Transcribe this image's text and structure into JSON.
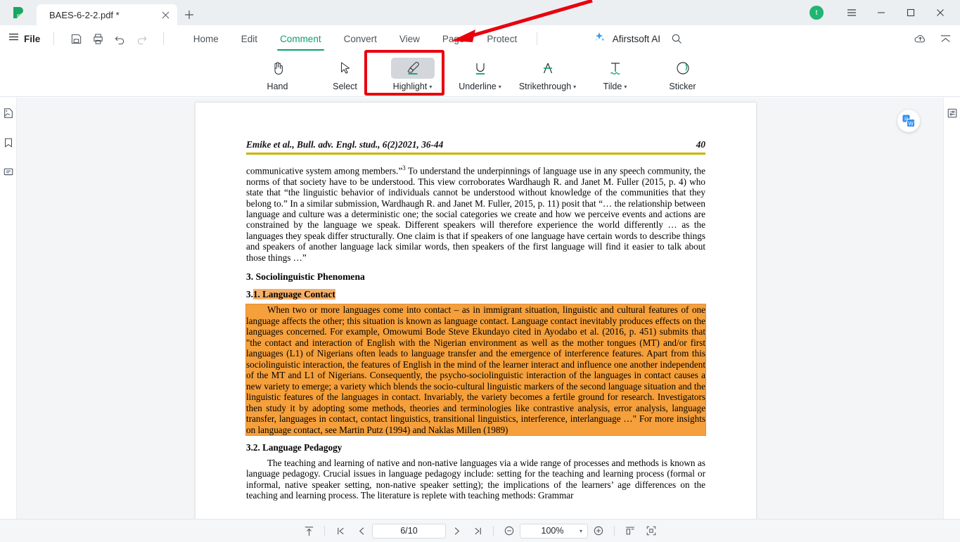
{
  "window": {
    "tab_title": "BAES-6-2-2.pdf *",
    "new_tab_icon": "plus-icon",
    "close_tab_icon": "close-icon",
    "avatar_letter": "t",
    "minimize_icon": "minimize-icon",
    "maximize_icon": "maximize-icon",
    "close_icon": "close-icon",
    "menu_icon": "hamburger-menu-icon"
  },
  "menu": {
    "file_label": "File",
    "quick_actions": [
      {
        "name": "save-icon",
        "label": "Save"
      },
      {
        "name": "print-icon",
        "label": "Print"
      },
      {
        "name": "undo-icon",
        "label": "Undo"
      },
      {
        "name": "redo-icon",
        "label": "Redo"
      }
    ],
    "tabs": [
      {
        "label": "Home",
        "active": false
      },
      {
        "label": "Edit",
        "active": false
      },
      {
        "label": "Comment",
        "active": true
      },
      {
        "label": "Convert",
        "active": false
      },
      {
        "label": "View",
        "active": false
      },
      {
        "label": "Page",
        "active": false
      },
      {
        "label": "Protect",
        "active": false
      }
    ],
    "ai_label": "Afirstsoft AI",
    "search_icon": "search-icon",
    "cloud_icon": "cloud-upload-icon",
    "collapse_icon": "collapse-ribbon-icon",
    "accent_color": "#0aa06e"
  },
  "ribbon": {
    "tools": [
      {
        "label": "Hand",
        "icon": "hand-icon",
        "dropdown": false,
        "active": false
      },
      {
        "label": "Select",
        "icon": "cursor-select-icon",
        "dropdown": false,
        "active": false
      },
      {
        "label": "Highlight",
        "icon": "highlighter-icon",
        "dropdown": true,
        "active": true
      },
      {
        "label": "Underline",
        "icon": "underline-icon",
        "dropdown": true,
        "active": false
      },
      {
        "label": "Strikethrough",
        "icon": "strikethrough-icon",
        "dropdown": true,
        "active": false
      },
      {
        "label": "Tilde",
        "icon": "tilde-icon",
        "dropdown": true,
        "active": false
      },
      {
        "label": "Sticker",
        "icon": "sticker-icon",
        "dropdown": false,
        "active": false
      }
    ],
    "caret_glyph": "▾"
  },
  "annotation": {
    "box_color": "#e8000d",
    "arrow_color": "#e8000d",
    "target": "Highlight",
    "arrow_points_to": "Comment"
  },
  "left_rail": [
    {
      "name": "thumbnails-icon",
      "label": "Thumbnails"
    },
    {
      "name": "bookmark-icon",
      "label": "Bookmarks"
    },
    {
      "name": "comments-panel-icon",
      "label": "Comments"
    }
  ],
  "right_rail": [
    {
      "name": "properties-panel-icon",
      "label": "Properties"
    }
  ],
  "floating": {
    "pdf_to_word_icon": "pdf-to-word-icon"
  },
  "document": {
    "header_left": "Emike et al., Bull. adv. Engl. stud., 6(2)2021, 36-44",
    "header_right": "40",
    "rule_color": "#c7b400",
    "highlight_color": "#f5a03c",
    "para1_a": "communicative system among members.”",
    "para1_sup": "3",
    "para1_b": " To understand the underpinnings of language use in any speech community, the norms of that society have to be understood. This view corroborates Wardhaugh R. and Janet M. Fuller (2015, p. 4) who state that “the linguistic behavior of individuals cannot be understood without knowledge of the communities that they belong to.” In a similar submission, Wardhaugh R. and Janet M. Fuller, 2015, p. 11) posit that “… the relationship between language and culture was a deterministic one; the social categories we create and how we perceive events and actions are constrained by the language we speak. Different speakers will therefore experience the world differently … as the languages they speak differ structurally. One claim is that if speakers of one language have certain words to describe things and speakers of another language lack similar words, then speakers of the first language will find it easier to talk about those things …”",
    "heading_3": "3.  Sociolinguistic Phenomena",
    "heading_31_num": "3.",
    "heading_31_hl": "1. Language Contact",
    "para_highlighted": "When two or more languages come into contact – as in immigrant situation, linguistic and cultural features of one language affects the other; this situation is known as language contact. Language contact inevitably produces effects on the languages concerned. For example, Omowumi Bode Steve Ekundayo cited in Ayodabo et al. (2016, p. 451) submits that \"the contact and interaction of English with the Nigerian environment as well as the mother tongues (MT) and/or first languages (L1) of Nigerians often leads to language transfer and the emergence of interference features. Apart from this sociolinguistic interaction, the features of English in the mind of the learner interact and influence one another independent of the MT and L1 of Nigerians. Consequently, the psycho-sociolinguistic interaction of the languages in contact causes a new variety to emerge; a variety which blends the socio-cultural linguistic markers of the second language situation and the linguistic features of the languages in contact. Invariably, the variety becomes a fertile ground for research. Investigators then study it by adopting some methods, theories and terminologies like contrastive analysis, error analysis, language transfer, languages in contact, contact linguistics, transitional linguistics, interference, interlanguage …\" For more insights on language contact, see Martin Putz (1994) and Naklas Millen (1989)",
    "para_highlighted_tail": ".",
    "heading_32": "3.2. Language Pedagogy",
    "para_last": "The teaching and learning of native and non-native languages via a wide range of processes and methods is known as language pedagogy. Crucial issues in language pedagogy include: setting for the teaching and learning process (formal or informal, native speaker setting, non-native speaker setting); the implications of the learners’ age differences on the teaching and learning process. The literature is replete with teaching methods: Grammar"
  },
  "statusbar": {
    "fit_page_icon": "fit-page-icon",
    "first_page_icon": "first-page-icon",
    "prev_page_icon": "prev-page-icon",
    "page_value": "6/10",
    "next_page_icon": "next-page-icon",
    "last_page_icon": "last-page-icon",
    "zoom_out_icon": "zoom-out-icon",
    "zoom_value": "100%",
    "zoom_caret": "▾",
    "zoom_in_icon": "zoom-in-icon",
    "single_page_icon": "single-page-view-icon",
    "fullscreen_icon": "fullscreen-icon"
  }
}
